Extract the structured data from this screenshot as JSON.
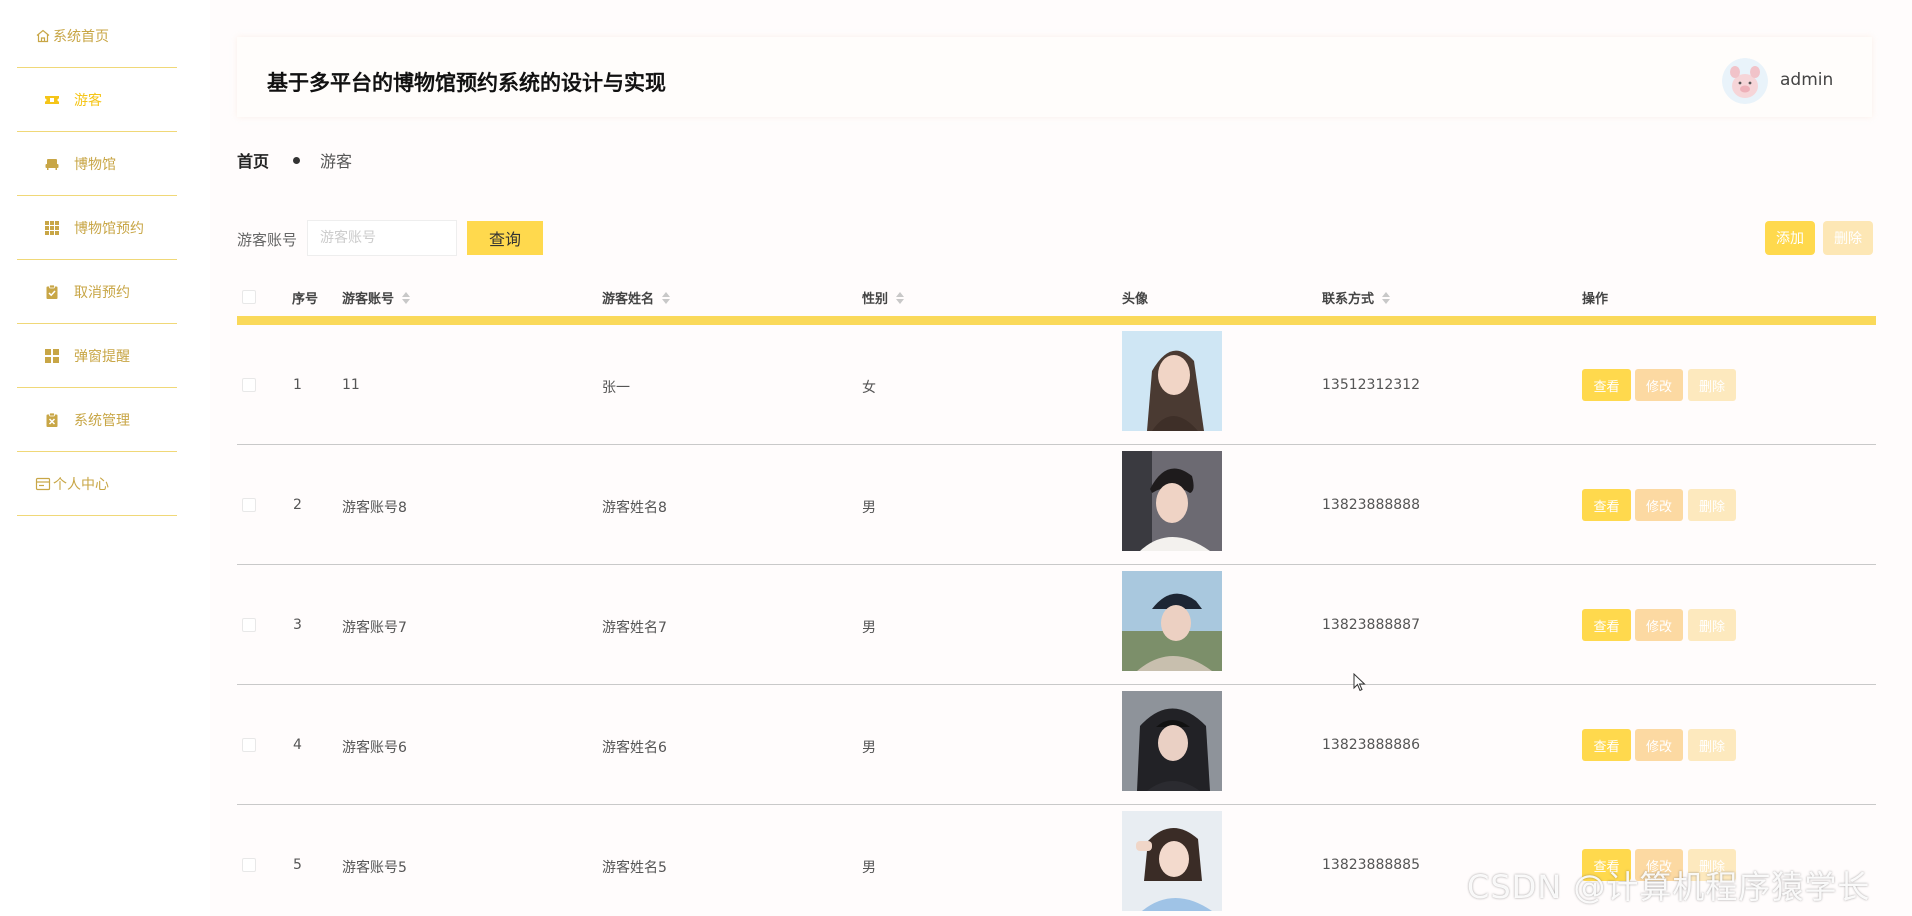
{
  "sidebar": {
    "items": [
      {
        "label": "系统首页",
        "icon": "home-icon"
      },
      {
        "label": "游客",
        "icon": "ticket-icon",
        "active": true
      },
      {
        "label": "博物馆",
        "icon": "couch-icon"
      },
      {
        "label": "博物馆预约",
        "icon": "grid-icon"
      },
      {
        "label": "取消预约",
        "icon": "clipboard-check-icon"
      },
      {
        "label": "弹窗提醒",
        "icon": "tiles-icon"
      },
      {
        "label": "系统管理",
        "icon": "clipboard-x-icon"
      },
      {
        "label": "个人中心",
        "icon": "window-icon"
      }
    ],
    "accent": "#f5c518",
    "text_color": "#c8a646"
  },
  "header": {
    "title": "基于多平台的博物馆预约系统的设计与实现",
    "user": "admin"
  },
  "breadcrumb": {
    "home": "首页",
    "current": "游客"
  },
  "search": {
    "label": "游客账号",
    "placeholder": "游客账号",
    "value": "",
    "query_button": "查询",
    "add_button": "添加",
    "delete_button": "删除"
  },
  "table": {
    "columns": {
      "index": "序号",
      "account": "游客账号",
      "name": "游客姓名",
      "gender": "性别",
      "avatar": "头像",
      "phone": "联系方式",
      "actions": "操作"
    },
    "rows": [
      {
        "index": "1",
        "account": "11",
        "name": "张一",
        "gender": "女",
        "phone": "13512312312"
      },
      {
        "index": "2",
        "account": "游客账号8",
        "name": "游客姓名8",
        "gender": "男",
        "phone": "13823888888"
      },
      {
        "index": "3",
        "account": "游客账号7",
        "name": "游客姓名7",
        "gender": "男",
        "phone": "13823888887"
      },
      {
        "index": "4",
        "account": "游客账号6",
        "name": "游客姓名6",
        "gender": "男",
        "phone": "13823888886"
      },
      {
        "index": "5",
        "account": "游客账号5",
        "name": "游客姓名5",
        "gender": "男",
        "phone": "13823888885"
      }
    ],
    "action_labels": {
      "view": "查看",
      "edit": "修改",
      "delete": "删除"
    },
    "header_bar_color": "#fad95a"
  },
  "watermark": "CSDN @计算机程序猿学长",
  "colors": {
    "primary_button": "#ffd94d",
    "edit_button": "#fcd9a2",
    "delete_button": "#fde9be",
    "background": "#fffcfc"
  }
}
